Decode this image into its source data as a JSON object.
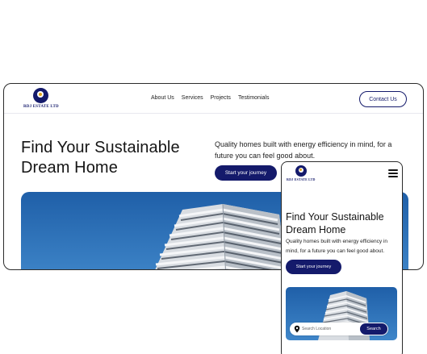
{
  "brand": {
    "name": "RDJ ESTATE LTD",
    "color": "#141a6b",
    "accent": "#e0a51c"
  },
  "desktop": {
    "nav": {
      "links": [
        "About Us",
        "Services",
        "Projects",
        "Testimonials"
      ],
      "contact_label": "Contact Us"
    },
    "hero": {
      "title_line1": "Find Your Sustainable",
      "title_line2": "Dream Home",
      "subtitle": "Quality homes built with energy efficiency in mind, for a future you can feel good about.",
      "cta_label": "Start your journey",
      "image": "modern-apartment-building-photo"
    }
  },
  "mobile": {
    "menu_icon": "hamburger-icon",
    "hero": {
      "title_line1": "Find Your Sustainable",
      "title_line2": "Dream Home",
      "subtitle": "Quality homes built with energy efficiency in mind, for a future you can feel good about.",
      "cta_label": "Start your journey",
      "image": "modern-apartment-building-photo"
    },
    "search": {
      "icon": "location-pin-icon",
      "placeholder": "Search Location",
      "button_label": "Search"
    }
  }
}
